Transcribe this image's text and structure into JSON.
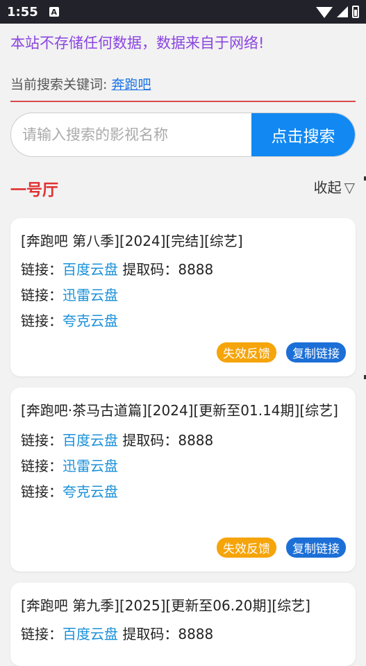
{
  "status": {
    "time": "1:55",
    "a_label": "A"
  },
  "notice": "本站不存储任何数据，数据来自于网络!",
  "keyword": {
    "label": "当前搜索关键词: ",
    "value": "奔跑吧"
  },
  "search": {
    "placeholder": "请输入搜索的影视名称",
    "button": "点击搜索"
  },
  "hall": {
    "title": "一号厅",
    "collapse": "收起",
    "collapse_icon": "▽"
  },
  "colors": {
    "notice": "#8a45e0",
    "accent_red": "#e03030",
    "link": "#1a90d9",
    "search_btn": "#1188f2",
    "feedback": "#f5a40a",
    "copy": "#1c6fd6"
  },
  "cards": [
    {
      "title": "[奔跑吧 第八季][2024][完结][综艺]",
      "links": [
        {
          "prefix": "链接：",
          "name": "百度云盘",
          "extra": " 提取码：8888"
        },
        {
          "prefix": "链接：",
          "name": "迅雷云盘",
          "extra": ""
        },
        {
          "prefix": "链接：",
          "name": "夸克云盘",
          "extra": ""
        }
      ],
      "feedback": "失效反馈",
      "copy": "复制链接"
    },
    {
      "title": "[奔跑吧·茶马古道篇][2024][更新至01.14期][综艺]",
      "links": [
        {
          "prefix": "链接：",
          "name": "百度云盘",
          "extra": " 提取码：8888"
        },
        {
          "prefix": "链接：",
          "name": "迅雷云盘",
          "extra": ""
        },
        {
          "prefix": "链接：",
          "name": "夸克云盘",
          "extra": ""
        }
      ],
      "feedback": "失效反馈",
      "copy": "复制链接"
    },
    {
      "title": "[奔跑吧 第九季][2025][更新至06.20期][综艺]",
      "links": [
        {
          "prefix": "链接：",
          "name": "百度云盘",
          "extra": " 提取码：8888"
        }
      ]
    }
  ]
}
